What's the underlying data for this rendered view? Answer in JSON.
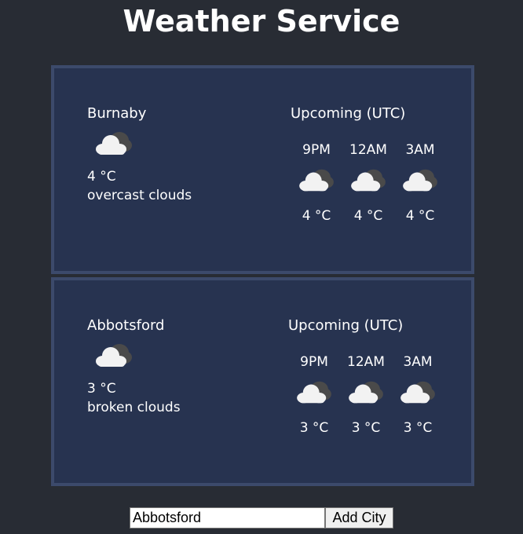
{
  "page": {
    "title": "Weather Service"
  },
  "cities": [
    {
      "name": "Burnaby",
      "icon": "cloud-icon",
      "temperature": "4 °C",
      "description": "overcast clouds",
      "upcoming_title": "Upcoming (UTC)",
      "forecast": [
        {
          "time": "9PM",
          "icon": "cloud-icon",
          "temperature": "4 °C"
        },
        {
          "time": "12AM",
          "icon": "cloud-icon",
          "temperature": "4 °C"
        },
        {
          "time": "3AM",
          "icon": "cloud-icon",
          "temperature": "4 °C"
        }
      ]
    },
    {
      "name": "Abbotsford",
      "icon": "cloud-icon",
      "temperature": "3 °C",
      "description": "broken clouds",
      "upcoming_title": "Upcoming (UTC)",
      "forecast": [
        {
          "time": "9PM",
          "icon": "cloud-icon",
          "temperature": "3 °C"
        },
        {
          "time": "12AM",
          "icon": "cloud-icon",
          "temperature": "3 °C"
        },
        {
          "time": "3AM",
          "icon": "cloud-icon",
          "temperature": "3 °C"
        }
      ]
    }
  ],
  "add_city": {
    "input_value": "Abbotsford",
    "button_label": "Add City"
  },
  "colors": {
    "page_background": "#282c34",
    "card_background": "#273350",
    "card_border": "#3c4a6b",
    "text": "#ffffff"
  }
}
